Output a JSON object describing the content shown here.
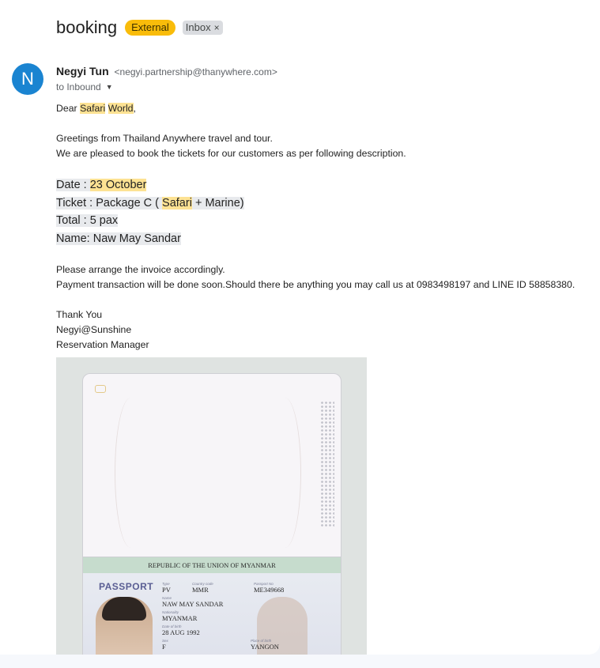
{
  "subject": "booking",
  "labels": {
    "external": "External",
    "inbox": "Inbox",
    "inbox_remove": "×"
  },
  "sender": {
    "avatar_letter": "N",
    "name": "Negyi Tun",
    "email": "<negyi.partnership@thanywhere.com>",
    "to_line": "to Inbound"
  },
  "body": {
    "greeting_prefix": "Dear ",
    "greeting_hl1": "Safari",
    "greeting_space": " ",
    "greeting_hl2": "World",
    "greeting_suffix": ",",
    "line1": "Greetings from Thailand Anywhere travel and tour.",
    "line2": "We are pleased to book the tickets for our customers as per following description.",
    "date_label": "Date : ",
    "date_value": "23 October",
    "ticket_prefix": "Ticket : Package C ( ",
    "ticket_hl": "Safari",
    "ticket_suffix": " + Marine)",
    "total": "Total : 5 pax",
    "name": "Name: Naw May Sandar",
    "arrange": "Please arrange the invoice accordingly.",
    "payment": "Payment transaction will be done soon.Should there be anything you may call us at 0983498197 and LINE ID 58858380.",
    "thanks": "Thank You",
    "signature": "Negyi@Sunshine",
    "role": "Reservation Manager"
  },
  "passport": {
    "republic": "REPUBLIC OF THE UNION OF MYANMAR",
    "title": "PASSPORT",
    "type_label": "Type",
    "type": "PV",
    "country_label": "Country code",
    "country": "MMR",
    "passport_no_label": "Passport No",
    "passport_no": "ME349668",
    "name_label": "Name",
    "name": "NAW MAY SANDAR",
    "nationality_label": "Nationality",
    "nationality": "MYANMAR",
    "dob_label": "Date of birth",
    "dob": "28 AUG 1992",
    "sex_label": "Sex",
    "sex": "F",
    "pob_label": "Place of birth",
    "pob": "YANGON"
  }
}
